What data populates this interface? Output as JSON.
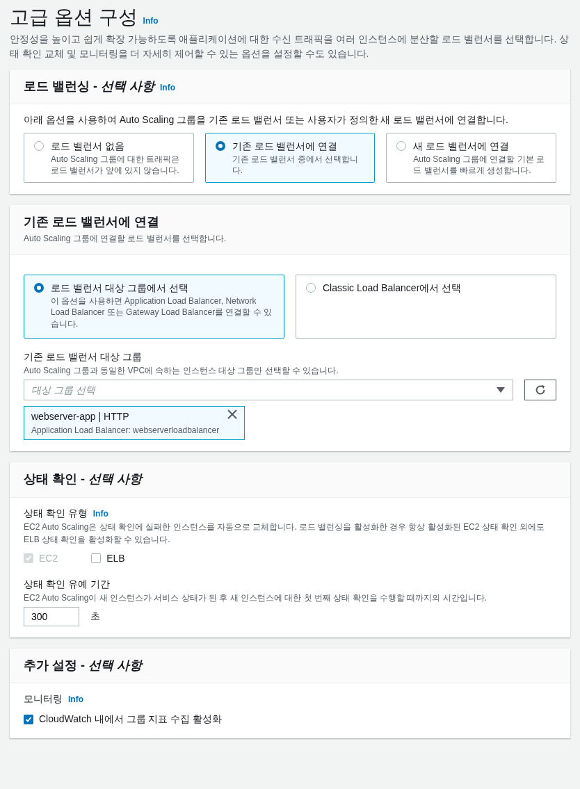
{
  "page": {
    "title": "고급 옵션 구성",
    "info": "Info",
    "description": "안정성을 높이고 쉽게 확장 가능하도록 애플리케이션에 대한 수신 트래픽을 여러 인스턴스에 분산할 로드 밸런서를 선택합니다. 상태 확인 교체 및 모니터링을 더 자세히 제어할 수 있는 옵션을 설정할 수도 있습니다."
  },
  "load_balancing": {
    "title": "로드 밸런싱 - *선택 사항*",
    "info": "Info",
    "intro": "아래 옵션을 사용하여 Auto Scaling 그룹을 기존 로드 밸런서 또는 사용자가 정의한 새 로드 밸런서에 연결합니다.",
    "options": [
      {
        "label": "로드 밸런서 없음",
        "description": "Auto Scaling 그룹에 대한 트래픽은 로드 밸런서가 앞에 있지 않습니다.",
        "selected": false
      },
      {
        "label": "기존 로드 밸런서에 연결",
        "description": "기존 로드 밸런서 중에서 선택합니다.",
        "selected": true
      },
      {
        "label": "새 로드 밸런서에 연결",
        "description": "Auto Scaling 그룹에 연결할 기본 로드 밸런서를 빠르게 생성합니다.",
        "selected": false
      }
    ]
  },
  "attach_existing": {
    "title": "기존 로드 밸런서에 연결",
    "subtitle": "Auto Scaling 그룹에 연결할 로드 밸런서를 선택합니다.",
    "options": [
      {
        "label": "로드 밸런서 대상 그룹에서 선택",
        "description": "이 옵션을 사용하면 Application Load Balancer, Network Load Balancer 또는 Gateway Load Balancer를 연결할 수 있습니다.",
        "selected": true
      },
      {
        "label": "Classic Load Balancer에서 선택",
        "selected": false
      }
    ],
    "target_group": {
      "label": "기존 로드 밸런서 대상 그룹",
      "hint": "Auto Scaling 그룹과 동일한 VPC에 속하는 인스턴스 대상 그룹만 선택할 수 있습니다.",
      "placeholder": "대상 그룹 선택"
    },
    "selected_items": [
      {
        "name": "webserver-app | HTTP",
        "detail": "Application Load Balancer: webserverloadbalancer"
      }
    ]
  },
  "health_check": {
    "title": "상태 확인 - *선택 사항*",
    "type_label": "상태 확인 유형",
    "info": "Info",
    "type_hint": "EC2 Auto Scaling은 상태 확인에 실패한 인스턴스를 자동으로 교체합니다. 로드 밸런싱을 활성화한 경우 항상 활성화된 EC2 상태 확인 외에도 ELB 상태 확인을 활성화할 수 있습니다.",
    "checks": [
      {
        "label": "EC2",
        "checked": true,
        "disabled": true
      },
      {
        "label": "ELB",
        "checked": false,
        "disabled": false
      }
    ],
    "grace_label": "상태 확인 유예 기간",
    "grace_hint": "EC2 Auto Scaling이 새 인스턴스가 서비스 상태가 된 후 새 인스턴스에 대한 첫 번째 상태 확인을 수행할 때까지의 시간입니다.",
    "grace_value": "300",
    "grace_unit": "초"
  },
  "additional": {
    "title": "추가 설정 - *선택 사항*",
    "monitoring_label": "모니터링",
    "info": "Info",
    "checks": [
      {
        "label": "CloudWatch 내에서 그룹 지표 수집 활성화",
        "checked": true,
        "disabled": false
      }
    ]
  }
}
